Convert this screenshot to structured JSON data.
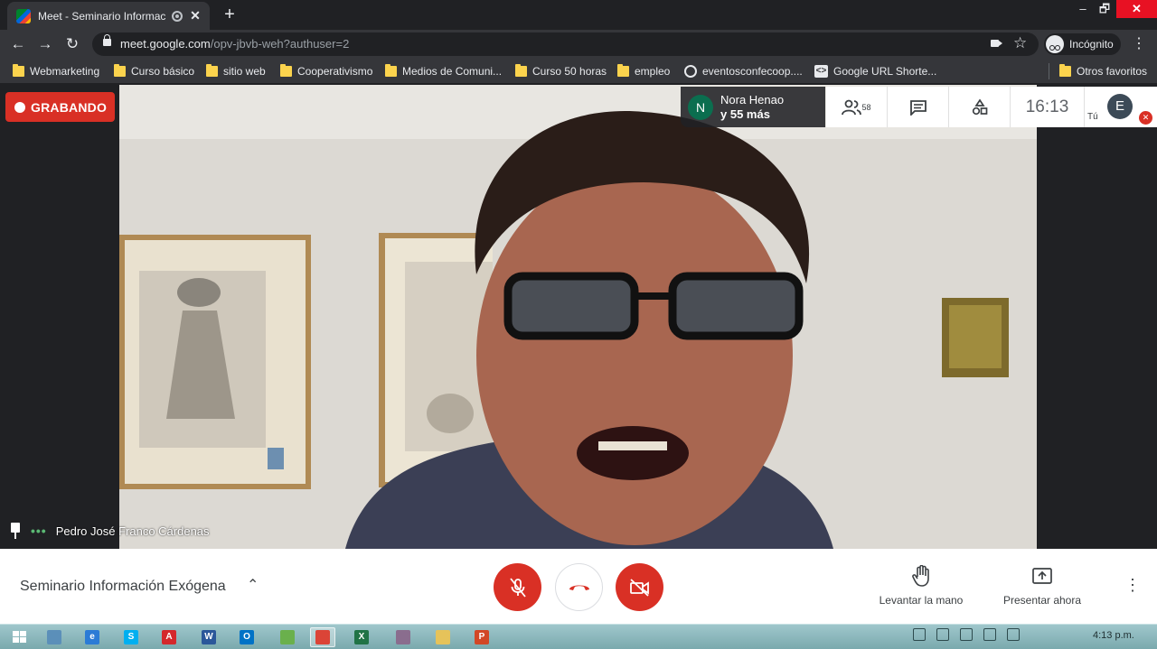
{
  "browser": {
    "tab": {
      "title": "Meet - Seminario Informació",
      "close": "✕"
    },
    "newtab": "+",
    "window": {
      "min": "–",
      "max": "🗗",
      "close": "✕"
    },
    "nav": {
      "back": "←",
      "forward": "→",
      "reload": "↻"
    },
    "url": {
      "host": "meet.google.com",
      "path": "/opv-jbvb-weh?authuser=2"
    },
    "star": "☆",
    "incognito_label": "Incógnito",
    "menu": "⋮"
  },
  "bookmarks": [
    {
      "label": "Webmarketing",
      "icon": "folder-icon"
    },
    {
      "label": "Curso básico",
      "icon": "folder-icon"
    },
    {
      "label": "sitio web",
      "icon": "folder-icon"
    },
    {
      "label": "Cooperativismo",
      "icon": "folder-icon"
    },
    {
      "label": "Medios de Comuni...",
      "icon": "folder-icon"
    },
    {
      "label": "Curso 50 horas",
      "icon": "folder-icon"
    },
    {
      "label": "empleo",
      "icon": "folder-icon"
    },
    {
      "label": "eventosconfecoop....",
      "icon": "globe-icon"
    },
    {
      "label": "Google URL Shorte...",
      "icon": "url-shortener-icon"
    },
    {
      "label": "Otros favoritos",
      "icon": "folder-icon"
    }
  ],
  "meet": {
    "recording_label": "GRABANDO",
    "participants_chip": {
      "avatar_letter": "N",
      "line1": "Nora Henao",
      "line2": "y 55 más"
    },
    "participant_count": "58",
    "clock": "16:13",
    "self": {
      "label": "Tú",
      "avatar_letter": "E"
    },
    "speaker_name": "Pedro José Franco Cárdenas",
    "meeting_title": "Seminario Información Exógena",
    "chevron": "⌃",
    "raise_hand_label": "Levantar la mano",
    "present_label": "Presentar ahora",
    "more": "⋮"
  },
  "taskbar": {
    "clock": "4:13 p.m.",
    "apps": [
      {
        "name": "ie",
        "letter": "e",
        "color": "#2b7bd6"
      },
      {
        "name": "skype",
        "letter": "S",
        "color": "#00aff0"
      },
      {
        "name": "acrobat",
        "letter": "A",
        "color": "#d4282c"
      },
      {
        "name": "word",
        "letter": "W",
        "color": "#2b579a"
      },
      {
        "name": "outlook",
        "letter": "O",
        "color": "#0072c6"
      },
      {
        "name": "app6",
        "letter": "",
        "color": "#6ab04c"
      },
      {
        "name": "chrome",
        "letter": "",
        "color": "#db4437"
      },
      {
        "name": "excel",
        "letter": "X",
        "color": "#217346"
      },
      {
        "name": "app9",
        "letter": "",
        "color": "#8a6d8e"
      },
      {
        "name": "explorer",
        "letter": "",
        "color": "#e6c35a"
      },
      {
        "name": "powerpoint",
        "letter": "P",
        "color": "#d24726"
      }
    ]
  },
  "colors": {
    "recording_red": "#d93025",
    "meet_dark": "#202124",
    "taskbar": "#8fb8bc"
  }
}
